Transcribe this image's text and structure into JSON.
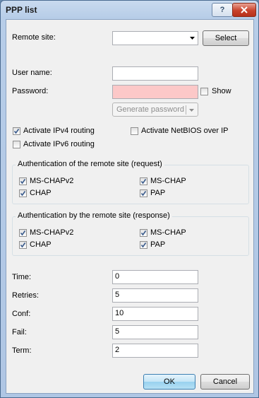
{
  "window": {
    "title": "PPP list"
  },
  "remote_site": {
    "label": "Remote site:",
    "value": "",
    "select_label": "Select"
  },
  "user_name": {
    "label": "User name:",
    "value": ""
  },
  "password": {
    "label": "Password:",
    "value": "",
    "show_label": "Show",
    "show_checked": false,
    "generate_label": "Generate password"
  },
  "routing": {
    "ipv4_label": "Activate IPv4 routing",
    "ipv4_checked": true,
    "netbios_label": "Activate NetBIOS over IP",
    "netbios_checked": false,
    "ipv6_label": "Activate IPv6 routing",
    "ipv6_checked": false
  },
  "auth_request": {
    "title": "Authentication of the remote site (request)",
    "mschapv2": "MS-CHAPv2",
    "mschap": "MS-CHAP",
    "chap": "CHAP",
    "pap": "PAP"
  },
  "auth_response": {
    "title": "Authentication by the remote site (response)",
    "mschapv2": "MS-CHAPv2",
    "mschap": "MS-CHAP",
    "chap": "CHAP",
    "pap": "PAP"
  },
  "timers": {
    "time_label": "Time:",
    "time_value": "0",
    "retries_label": "Retries:",
    "retries_value": "5",
    "conf_label": "Conf:",
    "conf_value": "10",
    "fail_label": "Fail:",
    "fail_value": "5",
    "term_label": "Term:",
    "term_value": "2"
  },
  "footer": {
    "ok_label": "OK",
    "cancel_label": "Cancel"
  }
}
